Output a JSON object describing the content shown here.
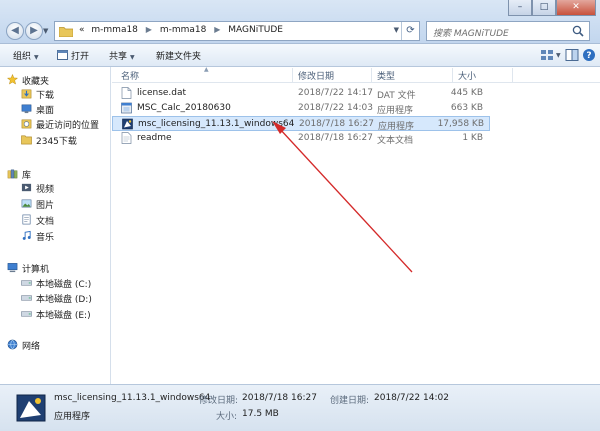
{
  "address": {
    "crumbs": [
      "m-mma18",
      "m-mma18",
      "MAGNiTUDE"
    ],
    "overflow_glyph": "«"
  },
  "search": {
    "placeholder": "搜索 MAGNiTUDE"
  },
  "window_buttons": {
    "minimize": "–",
    "maximize": "□",
    "close": "✕"
  },
  "toolbar": {
    "organize": "组织",
    "open": "打开",
    "share": "共享",
    "new_folder": "新建文件夹"
  },
  "nav": {
    "favorites": {
      "label": "收藏夹",
      "items": [
        "下载",
        "桌面",
        "最近访问的位置",
        "2345下载"
      ]
    },
    "libraries": {
      "label": "库",
      "items": [
        "视频",
        "图片",
        "文档",
        "音乐"
      ]
    },
    "computer": {
      "label": "计算机",
      "items": [
        "本地磁盘 (C:)",
        "本地磁盘 (D:)",
        "本地磁盘 (E:)"
      ]
    },
    "network": {
      "label": "网络"
    }
  },
  "columns": {
    "name": "名称",
    "modified": "修改日期",
    "type": "类型",
    "size": "大小"
  },
  "files": [
    {
      "name": "license.dat",
      "modified": "2018/7/22 14:17",
      "type": "DAT 文件",
      "size": "445 KB",
      "icon": "file-icon"
    },
    {
      "name": "MSC_Calc_20180630",
      "modified": "2018/7/22 14:03",
      "type": "应用程序",
      "size": "663 KB",
      "icon": "app-icon"
    },
    {
      "name": "msc_licensing_11.13.1_windows64",
      "modified": "2018/7/18 16:27",
      "type": "应用程序",
      "size": "17,958 KB",
      "icon": "installer-icon",
      "selected": true
    },
    {
      "name": "readme",
      "modified": "2018/7/18 16:27",
      "type": "文本文档",
      "size": "1 KB",
      "icon": "text-file-icon"
    }
  ],
  "details": {
    "name": "msc_licensing_11.13.1_windows64",
    "type": "应用程序",
    "modified_label": "修改日期:",
    "modified": "2018/7/18 16:27",
    "created_label": "创建日期:",
    "created": "2018/7/22 14:02",
    "size_label": "大小:",
    "size": "17.5 MB"
  },
  "colors": {
    "annotation_arrow": "#d42a2a",
    "selection": "#d6e8fc",
    "chrome": "#c2d6ee"
  }
}
